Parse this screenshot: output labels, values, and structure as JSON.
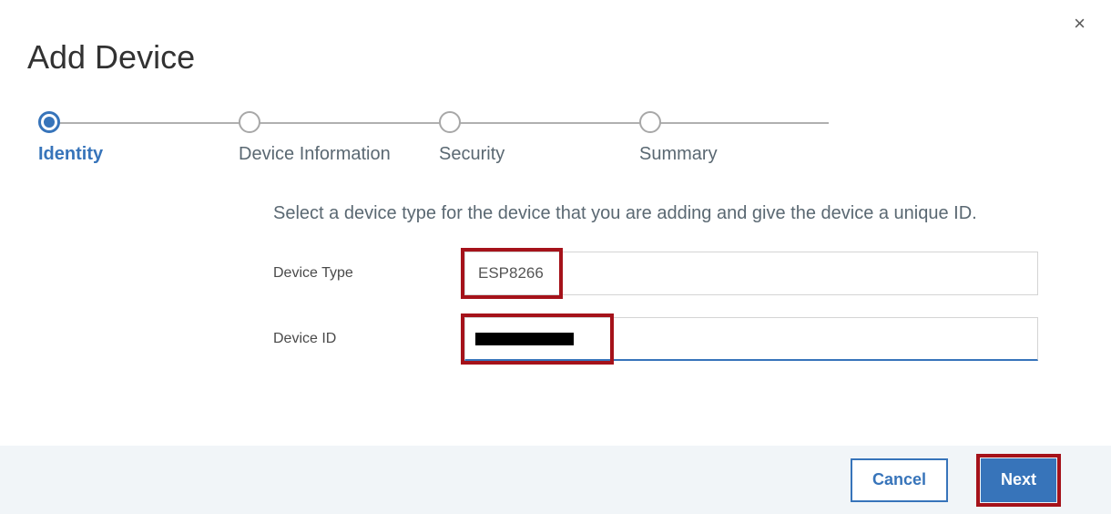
{
  "dialog": {
    "title": "Add Device",
    "close_icon": "×"
  },
  "stepper": {
    "steps": [
      {
        "label": "Identity",
        "active": true
      },
      {
        "label": "Device Information",
        "active": false
      },
      {
        "label": "Security",
        "active": false
      },
      {
        "label": "Summary",
        "active": false
      }
    ]
  },
  "form": {
    "instruction": "Select a device type for the device that you are adding and give the device a unique ID.",
    "device_type": {
      "label": "Device Type",
      "value": "ESP8266"
    },
    "device_id": {
      "label": "Device ID",
      "value": ""
    }
  },
  "footer": {
    "cancel_label": "Cancel",
    "next_label": "Next"
  }
}
